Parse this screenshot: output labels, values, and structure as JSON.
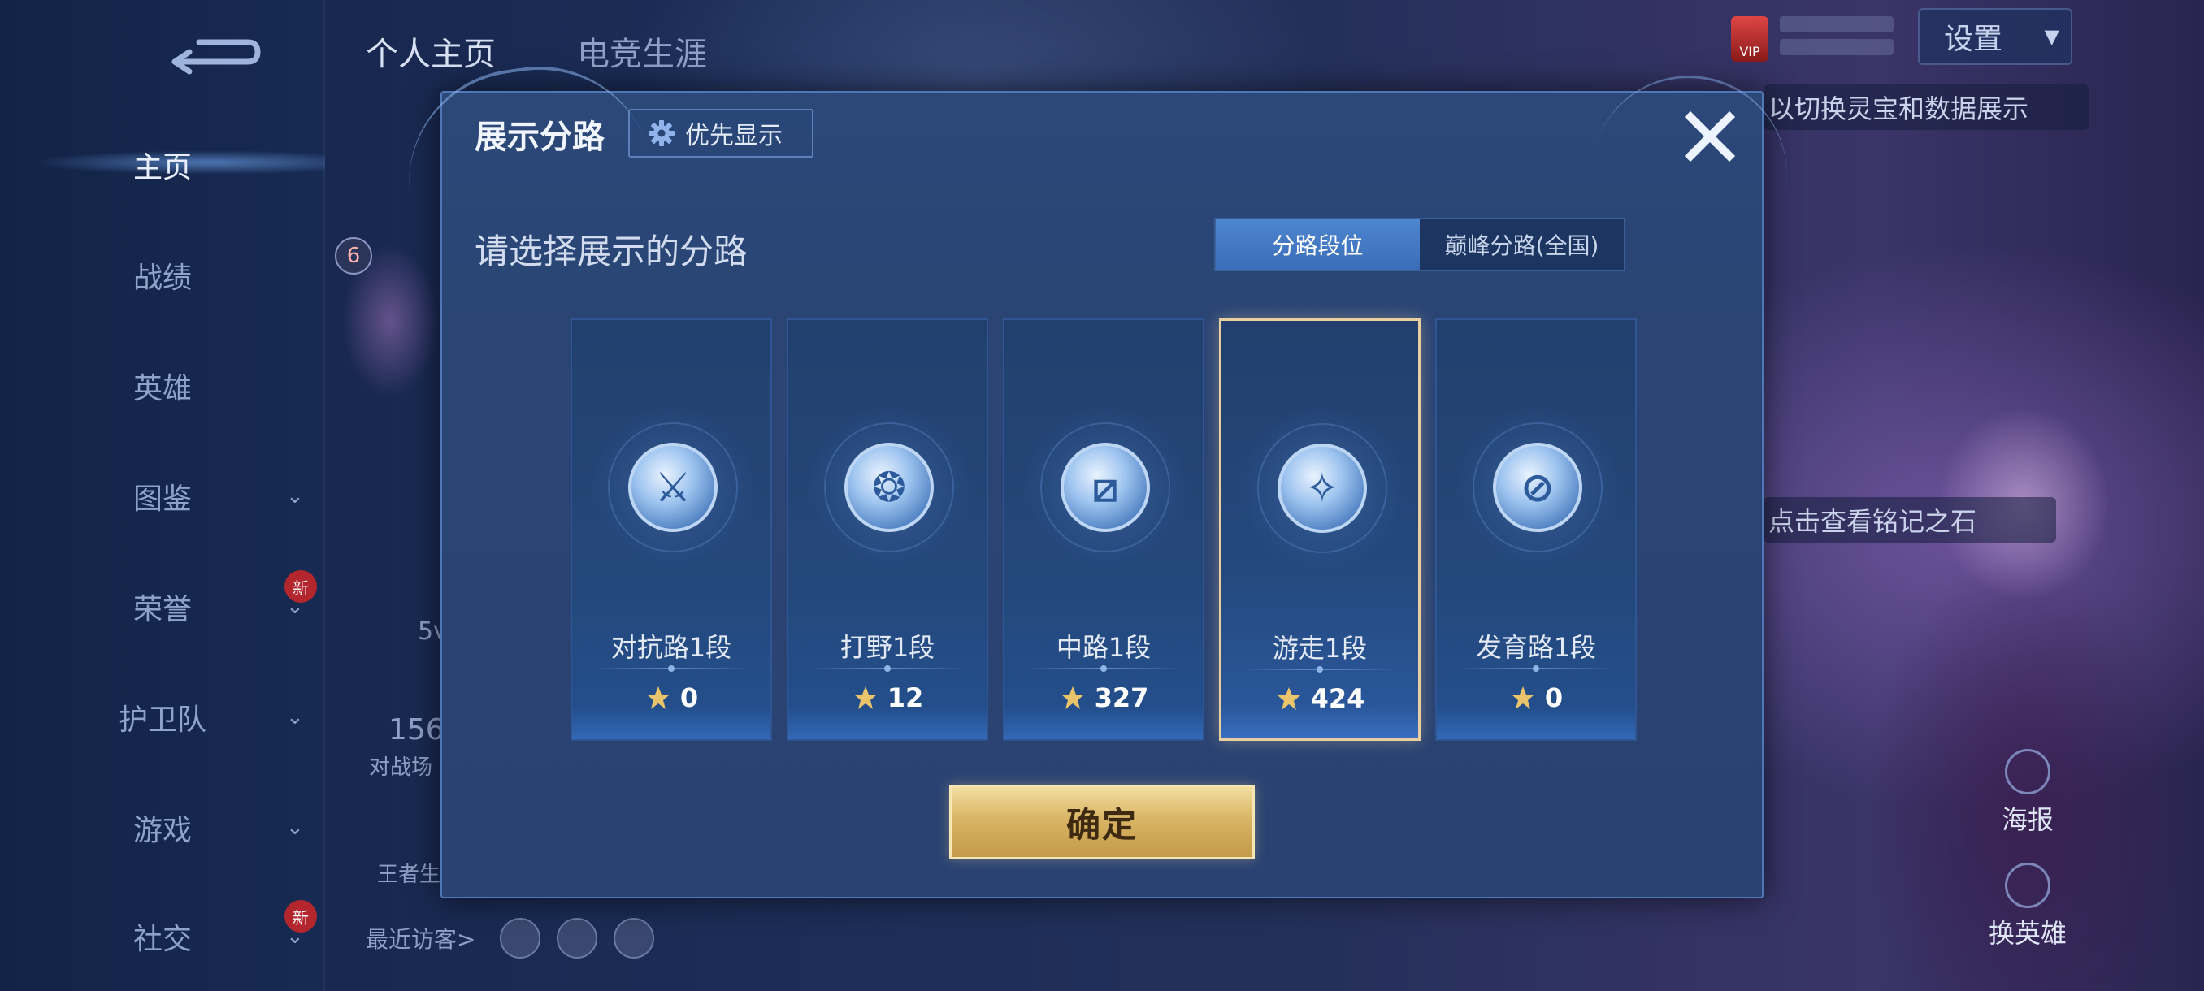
{
  "left_nav": {
    "items": [
      {
        "label": "主页",
        "active": true,
        "chevron": false,
        "new": false
      },
      {
        "label": "战绩",
        "active": false,
        "chevron": false,
        "new": false
      },
      {
        "label": "英雄",
        "active": false,
        "chevron": false,
        "new": false
      },
      {
        "label": "图鉴",
        "active": false,
        "chevron": true,
        "new": false
      },
      {
        "label": "荣誉",
        "active": false,
        "chevron": true,
        "new": true
      },
      {
        "label": "护卫队",
        "active": false,
        "chevron": true,
        "new": false
      },
      {
        "label": "游戏",
        "active": false,
        "chevron": true,
        "new": false
      },
      {
        "label": "社交",
        "active": false,
        "chevron": true,
        "new": true
      }
    ],
    "new_badge_text": "新"
  },
  "header": {
    "tabs": [
      "个人主页",
      "电竞生涯"
    ],
    "settings_label": "设置",
    "vip_label": "VIP"
  },
  "background": {
    "hint_top": "以切换灵宝和数据展示",
    "hint_mid": "点击查看铭记之石",
    "side_actions": [
      "海报",
      "换英雄"
    ],
    "recent_visitors_label": "最近访客>",
    "profile_badge": "6",
    "peek_texts": [
      "5v",
      "156",
      "对战场",
      "王者生"
    ]
  },
  "modal": {
    "title": "展示分路",
    "priority_label": "优先显示",
    "subtitle": "请选择展示的分路",
    "toggle": {
      "options": [
        "分路段位",
        "巅峰分路(全国)"
      ],
      "selected": "分路段位"
    },
    "lanes": [
      {
        "label": "对抗路1段",
        "score": "0",
        "icon": "clash-lane-icon",
        "selected": false
      },
      {
        "label": "打野1段",
        "score": "12",
        "icon": "jungle-icon",
        "selected": false
      },
      {
        "label": "中路1段",
        "score": "327",
        "icon": "mid-lane-icon",
        "selected": false
      },
      {
        "label": "游走1段",
        "score": "424",
        "icon": "roam-icon",
        "selected": true
      },
      {
        "label": "发育路1段",
        "score": "0",
        "icon": "farm-lane-icon",
        "selected": false
      }
    ],
    "confirm_label": "确定"
  },
  "colors": {
    "modal_bg": "#2a4473",
    "accent_blue": "#4e86d0",
    "selected_border": "#e9cfa0",
    "gold_button": "#d9b565"
  }
}
